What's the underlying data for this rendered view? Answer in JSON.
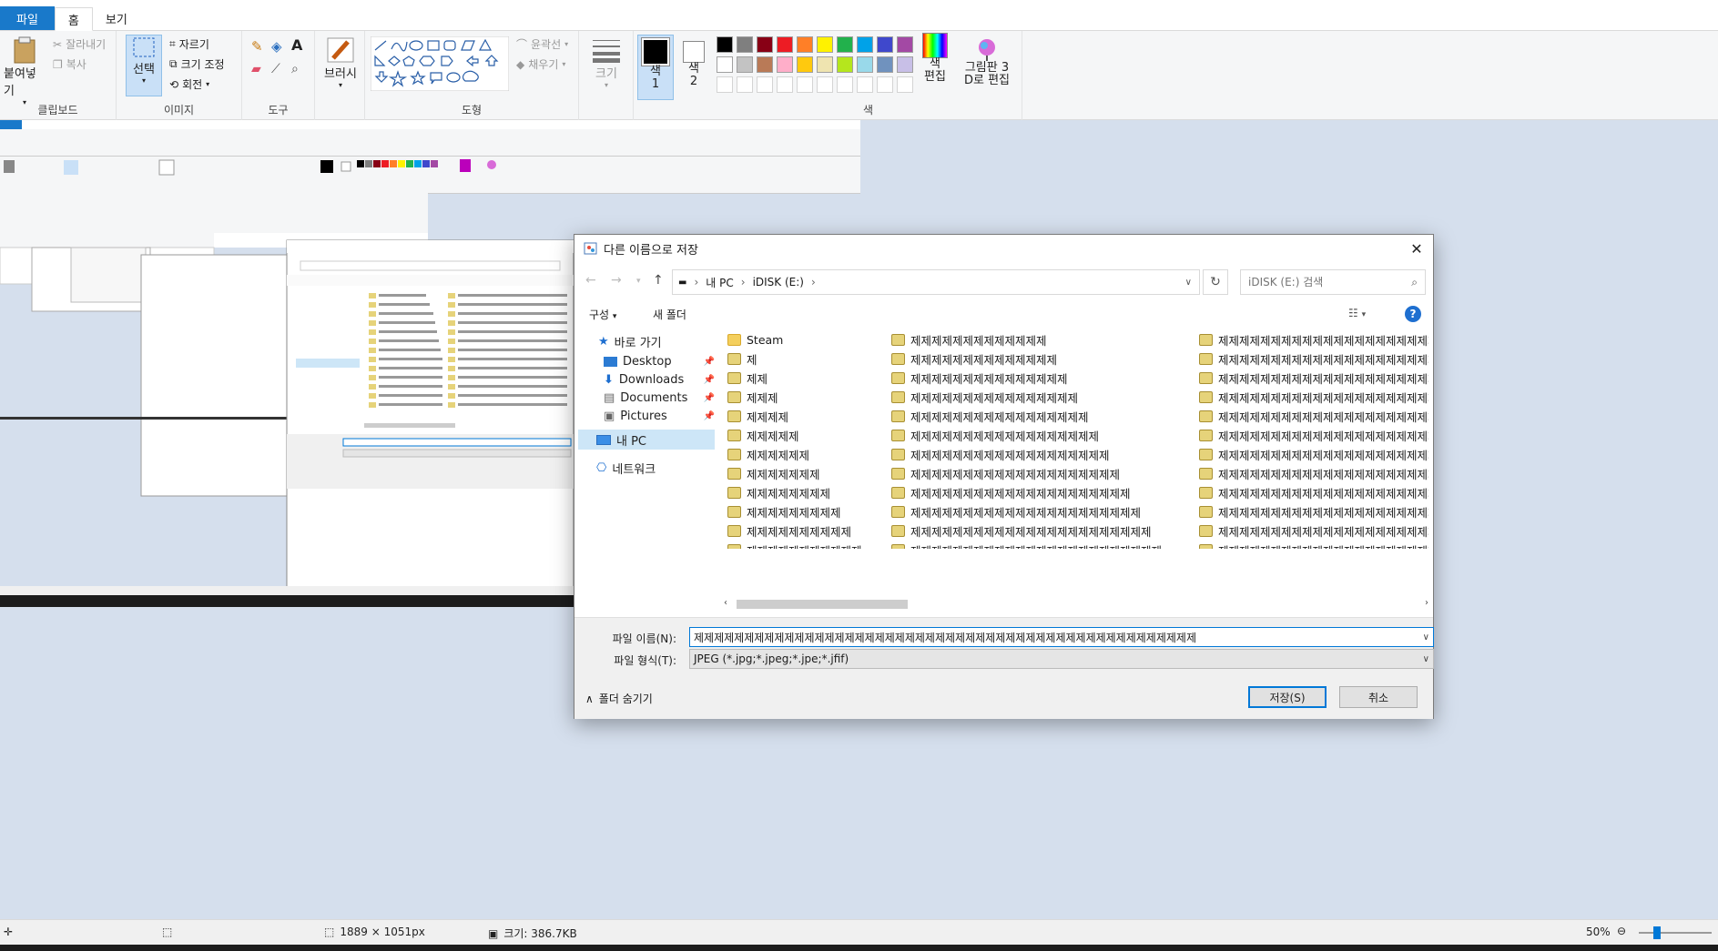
{
  "ribbon": {
    "tabs": [
      "파일",
      "홈",
      "보기"
    ],
    "clipboard": {
      "paste": "붙여넣기",
      "cut": "잘라내기",
      "copy": "복사",
      "label": "클립보드"
    },
    "image": {
      "select": "선택",
      "crop": "자르기",
      "resize": "크기 조정",
      "rotate": "회전",
      "label": "이미지"
    },
    "tools": {
      "label": "도구"
    },
    "brushes": {
      "label": "브러시"
    },
    "shapes": {
      "outline": "윤곽선",
      "fill": "채우기",
      "label": "도형"
    },
    "size": {
      "label": "크기"
    },
    "color1": {
      "label": "색\n1"
    },
    "color2": {
      "label": "색\n2"
    },
    "colors": {
      "label": "색",
      "edit": "색\n편집",
      "row1": [
        "#000000",
        "#7f7f7f",
        "#880015",
        "#ed1c24",
        "#ff7f27",
        "#fff200",
        "#22b14c",
        "#00a2e8",
        "#3f48cc",
        "#a349a4"
      ],
      "row2": [
        "#ffffff",
        "#c3c3c3",
        "#b97a57",
        "#ffaec9",
        "#ffc90e",
        "#efe4b0",
        "#b5e61d",
        "#99d9ea",
        "#7092be",
        "#c8bfe7"
      ]
    },
    "paint3d": "그림판 3\nD로 편집"
  },
  "dialog": {
    "title": "다른 이름으로 저장",
    "address": [
      "내 PC",
      "iDISK (E:)"
    ],
    "search_placeholder": "iDISK (E:) 검색",
    "organize": "구성",
    "new_folder": "새 폴더",
    "nav": {
      "quick_access": "바로 가기",
      "desktop": "Desktop",
      "downloads": "Downloads",
      "documents": "Documents",
      "pictures": "Pictures",
      "this_pc": "내 PC",
      "network": "네트워크"
    },
    "files": {
      "col1": [
        "Steam",
        "제",
        "제제",
        "제제제",
        "제제제제",
        "제제제제제",
        "제제제제제제",
        "제제제제제제제",
        "제제제제제제제제",
        "제제제제제제제제제",
        "제제제제제제제제제제",
        "제제제제제제제제제제제",
        "제제제제제제제제제제제제"
      ],
      "col2": [
        "제제제제제제제제제제제제제",
        "제제제제제제제제제제제제제제",
        "제제제제제제제제제제제제제제제",
        "제제제제제제제제제제제제제제제제",
        "제제제제제제제제제제제제제제제제제",
        "제제제제제제제제제제제제제제제제제제",
        "제제제제제제제제제제제제제제제제제제제",
        "제제제제제제제제제제제제제제제제제제제제",
        "제제제제제제제제제제제제제제제제제제제제제",
        "제제제제제제제제제제제제제제제제제제제제제제",
        "제제제제제제제제제제제제제제제제제제제제제제제",
        "제제제제제제제제제제제제제제제제제제제제제제제제",
        "제제제제제제제제제제제제제제제제제제제제제제제제제"
      ],
      "col3": [
        "제제제제제제제제제제제제제제제제제제제제제제제제제제",
        "제제제제제제제제제제제제제제제제제제제제제제제제제제",
        "제제제제제제제제제제제제제제제제제제제제제제제제제제",
        "제제제제제제제제제제제제제제제제제제제제제제제제제제",
        "제제제제제제제제제제제제제제제제제제제제제제제제제제",
        "제제제제제제제제제제제제제제제제제제제제제제제제제제",
        "제제제제제제제제제제제제제제제제제제제제제제제제제제",
        "제제제제제제제제제제제제제제제제제제제제제제제제제제",
        "제제제제제제제제제제제제제제제제제제제제제제제제제제",
        "제제제제제제제제제제제제제제제제제제제제제제제제제제",
        "제제제제제제제제제제제제제제제제제제제제제제제제제제",
        "제제제제제제제제제제제제제제제제제제제제제제제제제제",
        "제제제제제제제제제제제제제제제제제제제제제제제제제제"
      ]
    },
    "filename_label": "파일 이름(N):",
    "filename_value": "제제제제제제제제제제제제제제제제제제제제제제제제제제제제제제제제제제제제제제제제제제제제제제제제제제",
    "filetype_label": "파일 형식(T):",
    "filetype_value": "JPEG (*.jpg;*.jpeg;*.jpe;*.jfif)",
    "hide_folders": "폴더 숨기기",
    "save": "저장(S)",
    "cancel": "취소"
  },
  "status": {
    "dimensions": "1889 × 1051px",
    "size": "크기: 386.7KB",
    "zoom": "50%"
  }
}
